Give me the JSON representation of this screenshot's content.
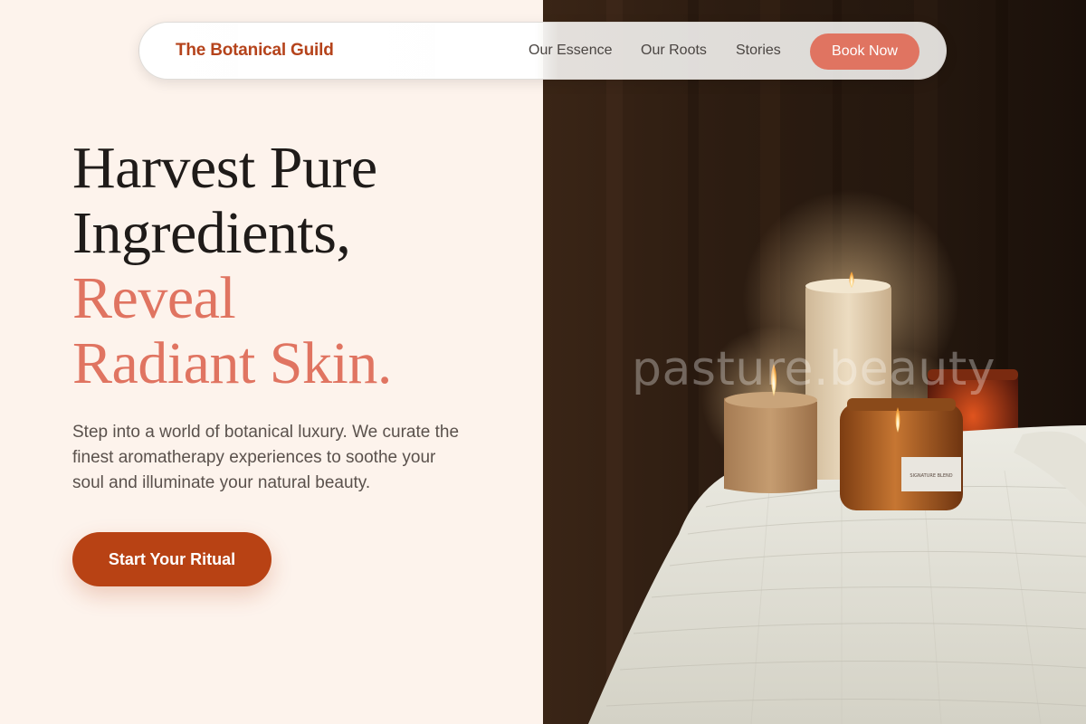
{
  "nav": {
    "brand": "The Botanical Guild",
    "links": [
      "Our Essence",
      "Our Roots",
      "Stories"
    ],
    "book_label": "Book Now"
  },
  "hero": {
    "title_line_1": "Harvest Pure",
    "title_line_2": "Ingredients,",
    "title_accent_1": "Reveal",
    "title_accent_2": "Radiant Skin.",
    "description": "Step into a world of botanical luxury. We curate the finest aromatherapy experiences to soothe your soul and illuminate your natural beauty.",
    "cta_label": "Start Your Ritual"
  },
  "image": {
    "watermark": "pasture.beauty",
    "jar_label": "SIGNATURE BLEND"
  },
  "colors": {
    "brand": "#b5431b",
    "accent": "#e07461",
    "cta": "#b84214",
    "background": "#fdf3ec",
    "heading": "#1f1b19"
  }
}
